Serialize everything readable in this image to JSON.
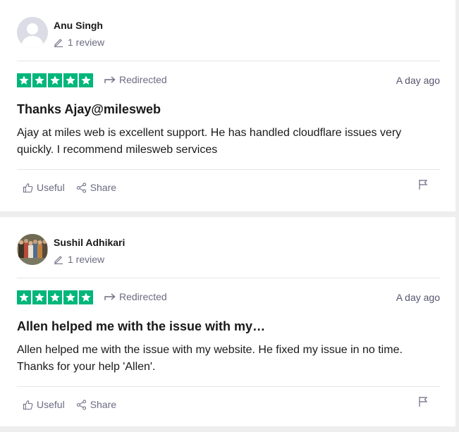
{
  "reviews": [
    {
      "author": "Anu Singh",
      "review_count": "1 review",
      "rating": 5,
      "source": "Redirected",
      "date": "A day ago",
      "title": "Thanks Ajay@milesweb",
      "body": "Ajay at miles web is excellent support. He has handled cloudflare issues very quickly. I recommend milesweb services",
      "useful_label": "Useful",
      "share_label": "Share"
    },
    {
      "author": "Sushil Adhikari",
      "review_count": "1 review",
      "rating": 5,
      "source": "Redirected",
      "date": "A day ago",
      "title": "Allen helped me with the issue with my…",
      "body": "Allen helped me with the issue with my website. He fixed my issue in no time. Thanks for your help 'Allen'.",
      "useful_label": "Useful",
      "share_label": "Share"
    }
  ],
  "colors": {
    "star_green": "#00b67a",
    "muted_text": "#6b6b83",
    "page_bg": "#eeeeee"
  },
  "icons": [
    "avatar-placeholder-icon",
    "pencil-icon",
    "star-icon",
    "redirect-arrow-icon",
    "thumbs-up-icon",
    "share-icon",
    "flag-icon"
  ]
}
